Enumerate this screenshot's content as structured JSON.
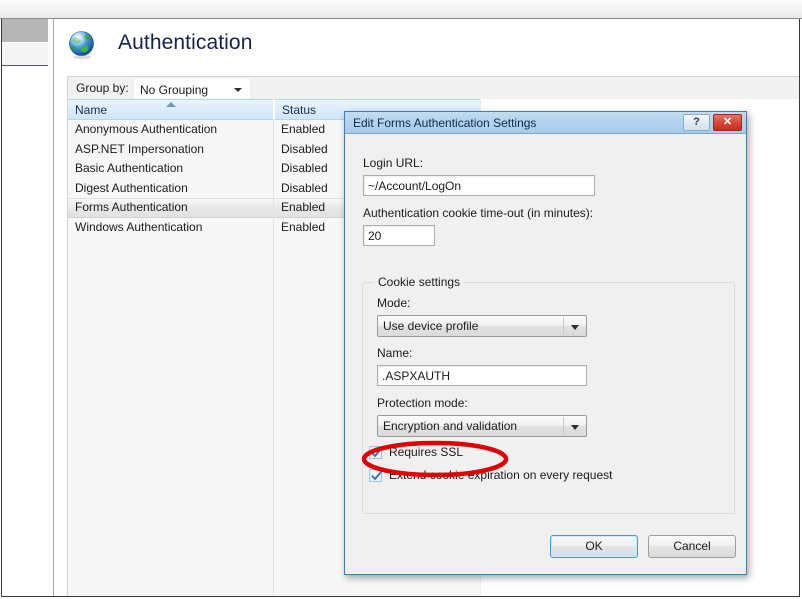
{
  "window": {
    "page_title": "Authentication",
    "globe_icon": "globe-icon"
  },
  "toolbar": {
    "group_by_label": "Group by:",
    "group_by_value": "No Grouping",
    "dropdown_icon": "chevron-down-icon"
  },
  "list": {
    "columns": [
      "Name",
      "Status"
    ],
    "sort_icon": "sort-ascending-icon",
    "rows": [
      {
        "name": "Anonymous Authentication",
        "status": "Enabled",
        "selected": false
      },
      {
        "name": "ASP.NET Impersonation",
        "status": "Disabled",
        "selected": false
      },
      {
        "name": "Basic Authentication",
        "status": "Disabled",
        "selected": false
      },
      {
        "name": "Digest Authentication",
        "status": "Disabled",
        "selected": false
      },
      {
        "name": "Forms Authentication",
        "status": "Enabled",
        "selected": true
      },
      {
        "name": "Windows Authentication",
        "status": "Enabled",
        "selected": false
      }
    ]
  },
  "dialog": {
    "title": "Edit Forms Authentication Settings",
    "help_button": "?",
    "close_button": "✕",
    "login_url_label": "Login URL:",
    "login_url_value": "~/Account/LogOn",
    "timeout_label": "Authentication cookie time-out (in minutes):",
    "timeout_value": "20",
    "cookie_group_title": "Cookie settings",
    "mode_label": "Mode:",
    "mode_value": "Use device profile",
    "name_label": "Name:",
    "name_value": ".ASPXAUTH",
    "protection_label": "Protection mode:",
    "protection_value": "Encryption and validation",
    "requires_ssl_label": "Requires SSL",
    "requires_ssl_checked": true,
    "extend_cookie_label": "Extend cookie expiration on every request",
    "extend_cookie_checked": true,
    "ok_label": "OK",
    "cancel_label": "Cancel"
  },
  "annotation": {
    "shape": "ellipse",
    "color": "#e00000",
    "target": "Requires SSL"
  },
  "colors": {
    "titlebar_blue": "#a8cbeb",
    "close_red": "#c32f20",
    "dialog_bg": "#f0f0f0",
    "header_gradient": "#cfe6f9",
    "title_text": "#15224b",
    "annotation_red": "#e00000"
  }
}
